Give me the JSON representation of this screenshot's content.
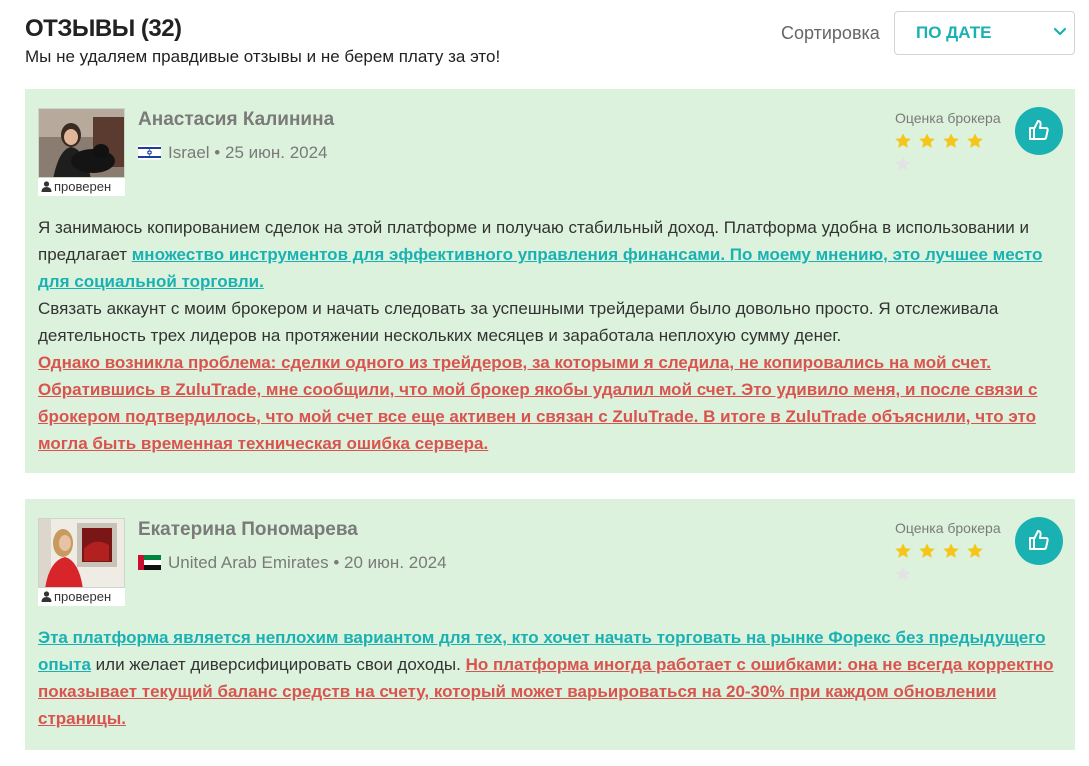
{
  "header": {
    "title": "ОТЗЫВЫ (32)",
    "subtitle": "Мы не удаляем правдивые отзывы и не берем плату за это!",
    "sort_label": "Сортировка",
    "sort_value": "ПО ДАТЕ"
  },
  "colors": {
    "accent": "#1ab1b3",
    "negative": "#d9534f",
    "card_bg": "#dcf2dc",
    "star": "#f5c518",
    "star_empty": "#e0e0e0"
  },
  "reviews": [
    {
      "name": "Анастасия Калинина",
      "country": "Israel",
      "date": "25 июн. 2024",
      "verified_label": "проверен",
      "rating_label": "Оценка брокера",
      "rating": 4,
      "rating_max": 5,
      "text": {
        "p1": "Я занимаюсь копированием сделок на этой платформе и получаю стабильный доход. Платформа удобна в использовании и предлагает ",
        "p1_highlight": "множество инструментов для эффективного управления финансами. По моему мнению, это лучшее место для социальной торговли.",
        "p2": "Связать аккаунт с моим брокером и начать следовать за успешными трейдерами было довольно просто. Я отслеживала деятельность трех лидеров на протяжении нескольких месяцев и заработала неплохую сумму денег.",
        "p3_highlight": "Однако возникла проблема: сделки одного из трейдеров, за которыми я следила, не копировались на мой счет. Обратившись в ZuluTrade, мне сообщили, что мой брокер якобы удалил мой счет. Это удивило меня, и после связи с брокером подтвердилось, что мой счет все еще активен и связан с ZuluTrade. В итоге в ZuluTrade объяснили, что это могла быть временная техническая ошибка сервера."
      }
    },
    {
      "name": "Екатерина Пономарева",
      "country": "United Arab Emirates",
      "date": "20 июн. 2024",
      "verified_label": "проверен",
      "rating_label": "Оценка брокера",
      "rating": 4,
      "rating_max": 5,
      "text": {
        "good_highlight": "Эта платформа является неплохим вариантом для тех, кто хочет начать торговать на рынке Форекс без предыдущего опыта",
        "middle": " или желает диверсифицировать свои доходы. ",
        "bad_highlight": "Но платформа иногда работает с ошибками: она не всегда корректно показывает текущий баланс средств на счету, который может варьироваться на 20-30% при каждом обновлении страницы."
      }
    }
  ]
}
